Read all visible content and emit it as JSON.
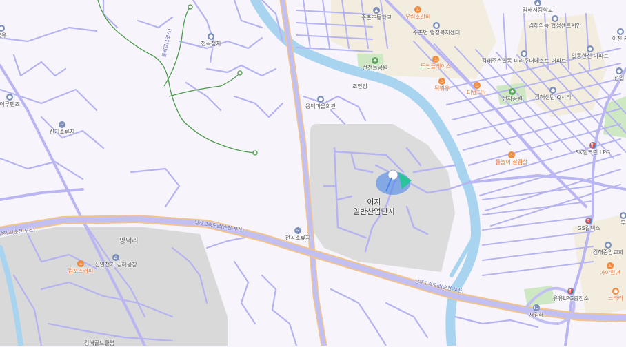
{
  "colors": {
    "background": "#f7f5fb",
    "road": "#b5b3f0",
    "highway": "#c2bff2",
    "highway_outline": "#f2c48a",
    "river": "#a8d4f0",
    "industrial": "#dadada",
    "park": "#cfe8c4",
    "trail": "#4c9a4c",
    "poi_gray": "#7b8fb8",
    "poi_food": "#f08a3c",
    "poi_park": "#5aa85a",
    "poi_gas": "#4a90d9",
    "location": "#4a86e8",
    "location_accent": "#2bc39a"
  },
  "labels": {
    "industrial_complex": [
      "이지",
      "일반산업단지"
    ],
    "village": "망덕리",
    "joan_river": "조안강",
    "trail": "둘레길(1코스)",
    "expressway_1": "남해고속도로(순천-부산)",
    "expressway_2": "남해고속도로(순천-부산)",
    "expressway_left": "남해고(순천-부산)",
    "bottom_left_partial": "김해골드클럽"
  },
  "pois": [
    {
      "id": "jeongok-jeongja",
      "name": "전곡정자",
      "icon": "pin-icon",
      "kind": "gray"
    },
    {
      "id": "yongdeok-hall",
      "name": "용덕마을회관",
      "icon": "pin-icon",
      "kind": "gray"
    },
    {
      "id": "jeongok-rest",
      "name": "전곡소류지",
      "icon": "water-icon",
      "kind": "gray"
    },
    {
      "id": "singi-rest",
      "name": "신기소류지",
      "icon": "water-icon",
      "kind": "gray"
    },
    {
      "id": "park-pg",
      "name": "이루펜즈",
      "icon": "pin-icon",
      "kind": "gray"
    },
    {
      "id": "yulyu",
      "name": "율유",
      "icon": "pin-icon",
      "kind": "gray"
    },
    {
      "id": "compose",
      "name": "컴포즈커피",
      "icon": "cup-icon",
      "kind": "food"
    },
    {
      "id": "factory",
      "name": "신일전기 김해공장",
      "icon": "factory-icon",
      "kind": "gray"
    },
    {
      "id": "juchon-school",
      "name": "주촌초등학교",
      "icon": "school-icon",
      "kind": "gray"
    },
    {
      "id": "juchon-center",
      "name": "주촌면 행정복지센터",
      "icon": "pin-icon",
      "kind": "gray"
    },
    {
      "id": "uyeon",
      "name": "우림소갈비",
      "icon": "food-icon",
      "kind": "food"
    },
    {
      "id": "twosome",
      "name": "투썸플레이스",
      "icon": "food-icon",
      "kind": "food"
    },
    {
      "id": "dwaebae",
      "name": "뒤뷔유",
      "icon": "food-icon",
      "kind": "food"
    },
    {
      "id": "dalbi",
      "name": "더벤티노",
      "icon": "food-icon",
      "kind": "food"
    },
    {
      "id": "seoncheon-park",
      "name": "선천들공원",
      "icon": "park-icon",
      "kind": "park"
    },
    {
      "id": "seonji-park",
      "name": "선지공원",
      "icon": "park-icon",
      "kind": "park"
    },
    {
      "id": "gimhae-seo",
      "name": "김해서중학교",
      "icon": "school-icon",
      "kind": "gray"
    },
    {
      "id": "gimhae-apt",
      "name": "김해외동 협성센트시안",
      "icon": "pin-icon",
      "kind": "gray"
    },
    {
      "id": "ilsong",
      "name": "일동한신 아파트",
      "icon": "pin-icon",
      "kind": "gray"
    },
    {
      "id": "juchon-apt",
      "name": "김해주촌일동 미라주더네스트 어파트",
      "icon": "pin-icon",
      "kind": "gray"
    },
    {
      "id": "qcity",
      "name": "김해센텀 Q시티",
      "icon": "pin-icon",
      "kind": "gray"
    },
    {
      "id": "samgyeop",
      "name": "돌놀이 삼겹살",
      "icon": "food-icon",
      "kind": "food"
    },
    {
      "id": "sk-lpg",
      "name": "SK엔크린 LPG",
      "icon": "gas-icon",
      "kind": "gas"
    },
    {
      "id": "gs-station",
      "name": "GS칼텍스",
      "icon": "gas-icon",
      "kind": "gas"
    },
    {
      "id": "gimhae-central",
      "name": "김해중앙교회",
      "icon": "pin-icon",
      "kind": "gray"
    },
    {
      "id": "gaya-mil",
      "name": "가야밀면",
      "icon": "food-icon",
      "kind": "food"
    },
    {
      "id": "lpg-station",
      "name": "유유LPG충전소",
      "icon": "gas-icon",
      "kind": "gas"
    },
    {
      "id": "seogimhae-ic",
      "name": "서김해",
      "icon": "ic-icon",
      "kind": "gray"
    },
    {
      "id": "nubi",
      "name": "느타리",
      "icon": "pin-icon",
      "kind": "food"
    },
    {
      "id": "ijin",
      "name": "이진 캐",
      "icon": "pin-icon",
      "kind": "gray"
    },
    {
      "id": "cheonil",
      "name": "천일",
      "icon": "pin-icon",
      "kind": "gray"
    },
    {
      "id": "bu",
      "name": "부",
      "icon": "pin-icon",
      "kind": "gray"
    }
  ]
}
